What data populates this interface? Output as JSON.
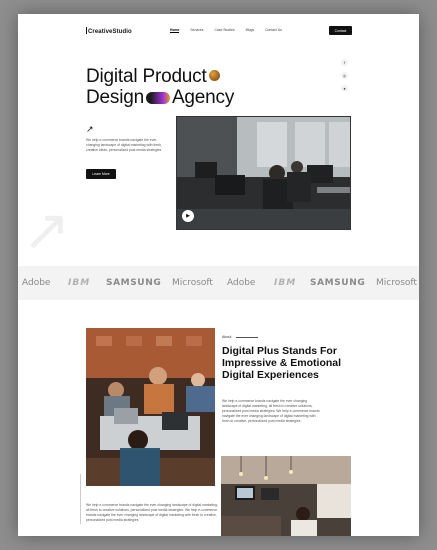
{
  "nav": {
    "logo": "CreativeStudio",
    "links": [
      "Home",
      "Services",
      "Case Studies",
      "Blogs",
      "Contact Us"
    ],
    "cta": "Contact"
  },
  "hero": {
    "title_line1": "Digital Product",
    "title_line2a": "Design",
    "title_line2b": "Agency",
    "description": "We help e-commerce brands navigate the ever changing landscape of digital marketing with fresh, creative ideas, personalized post media strategies",
    "button": "Learn More",
    "socials": [
      "f",
      "◎",
      "♥"
    ]
  },
  "logos": [
    "Adobe",
    "IBM",
    "SAMSUNG",
    "Microsoft",
    "Adobe",
    "IBM",
    "SAMSUNG",
    "Microsoft"
  ],
  "about": {
    "label": "About",
    "title": "Digital Plus Stands For Impressive & Emotional Digital Experiences",
    "text": "We help e-commerce brands navigate the ever changing landscape of digital marketing, all fresh to creative solutions, personalized post media strategies. We help e-commerce brands navigate the ever changing landscape of digital marketing with fresh to creative, personalized post media strategies",
    "text2": "We help e-commerce brands navigate the ever changing landscape of digital marketing, all fresh to creative solutions, personalized post media strategies. We help e-commerce brands navigate the ever changing landscape of digital marketing with fresh to creative, personalized post media strategies"
  },
  "colors": {
    "accent": "#111111",
    "page": "#ffffff",
    "backdrop": "#8e8e8e"
  }
}
